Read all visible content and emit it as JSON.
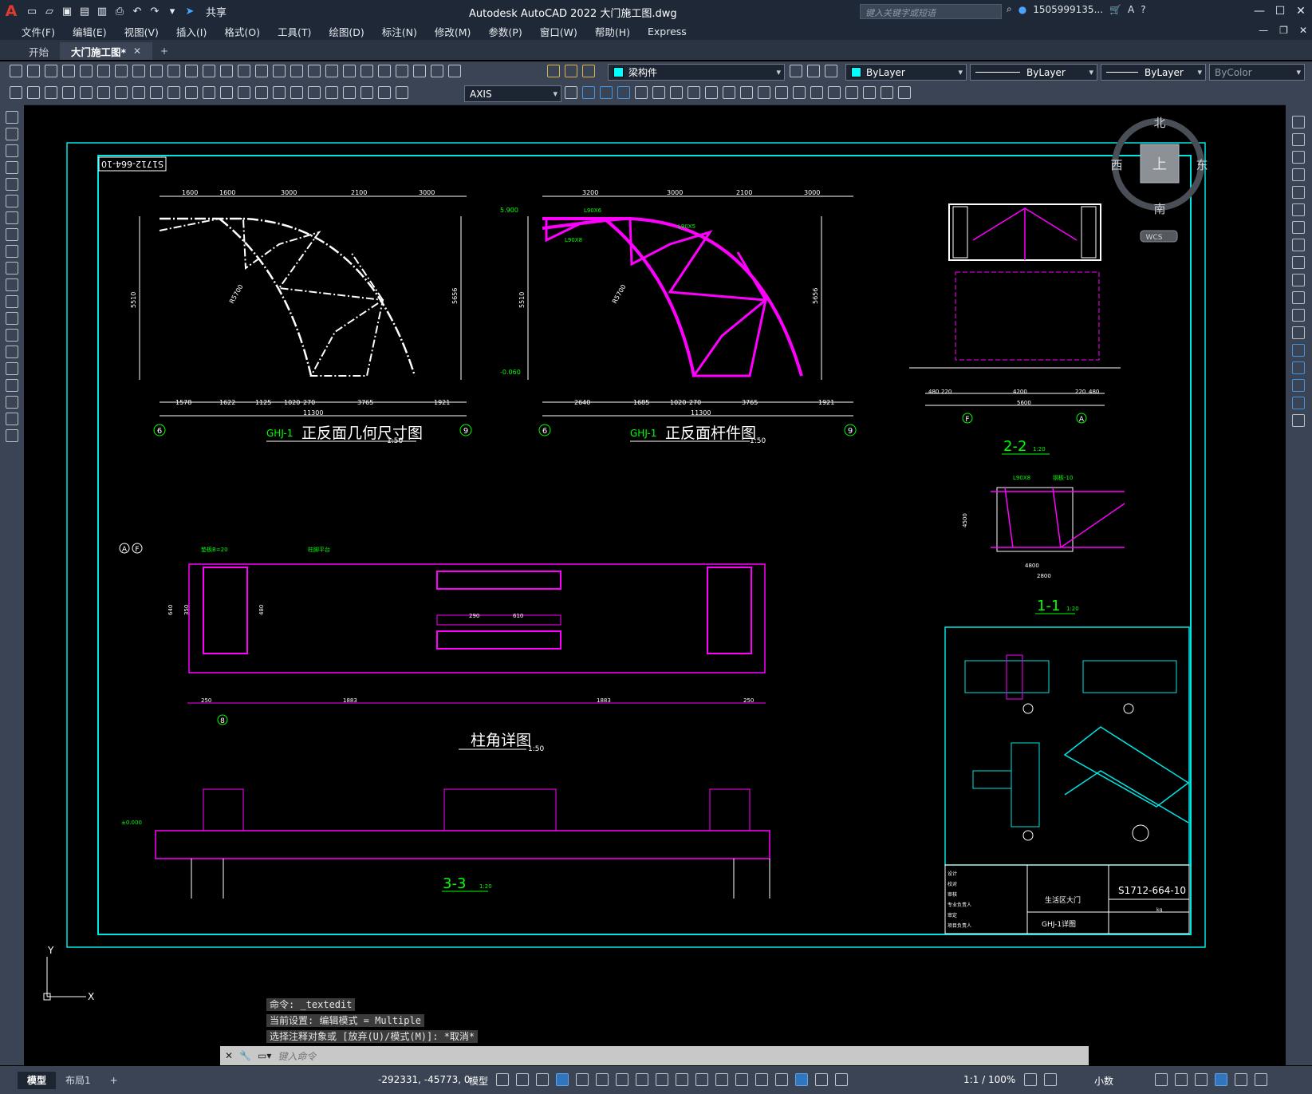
{
  "app": {
    "logo": "A",
    "title": "Autodesk AutoCAD 2022    大门施工图.dwg",
    "share": "共享",
    "search_placeholder": "键入关键字或短语",
    "user": "1505999135...",
    "help": "?"
  },
  "menu": [
    "文件(F)",
    "编辑(E)",
    "视图(V)",
    "插入(I)",
    "格式(O)",
    "工具(T)",
    "绘图(D)",
    "标注(N)",
    "修改(M)",
    "参数(P)",
    "窗口(W)",
    "帮助(H)",
    "Express"
  ],
  "file_tabs": {
    "start": "开始",
    "active": "大门施工图*",
    "close": "✕",
    "add": "+"
  },
  "toolbar": {
    "layer": "梁构件",
    "color": "ByLayer",
    "linetype": "ByLayer",
    "lineweight": "ByLayer",
    "plotstyle": "ByColor",
    "dimstyle": "AXIS"
  },
  "viewcube": {
    "north": "北",
    "south": "南",
    "east": "东",
    "west": "西",
    "top": "上",
    "wcs": "WCS"
  },
  "colors": {
    "frame": "#00e5e5",
    "magenta": "#ff00ff",
    "green": "#00ff00",
    "white": "#ffffff",
    "accent": "#2f7fd1"
  },
  "drawing": {
    "sheet_no_box": "S1712-664-10",
    "view1": {
      "title": "正反面几何尺寸图",
      "prefix": "GHJ-1",
      "scale": "1:50",
      "top_dims": [
        "1600",
        "1600",
        "3000",
        "2100",
        "3000"
      ],
      "bottom_dims": [
        "1578",
        "1622",
        "1125",
        "1020",
        "270",
        "3765",
        "1921"
      ],
      "total": "11300",
      "left_height": "5510",
      "right_height": "5656",
      "radius": "R5700",
      "axis_left": "6",
      "axis_right": "9"
    },
    "view2": {
      "title": "正反面杆件图",
      "prefix": "GHJ-1",
      "scale": "1:50",
      "top_dims": [
        "3200",
        "3000",
        "2100",
        "3000"
      ],
      "bottom_dims": [
        "2640",
        "1685",
        "1020",
        "270",
        "3765",
        "1921"
      ],
      "total": "11300",
      "left_height": "5510",
      "right_height": "5656",
      "elev_top": "5.900",
      "elev_bottom": "-0.060",
      "axis_left": "6",
      "axis_right": "9",
      "members": [
        "L90X6",
        "L90X8",
        "L90X5",
        "R5700"
      ]
    },
    "section22": {
      "title": "2-2",
      "scale": "1:20",
      "dims": [
        "480",
        "220",
        "4200",
        "220",
        "480"
      ],
      "total": "5600",
      "axis_left": "F",
      "axis_right": "A"
    },
    "section11": {
      "title": "1-1",
      "scale": "1:20",
      "dims": [
        "4800",
        "2800"
      ],
      "height": "4500",
      "labels": [
        "L90X8",
        "钢板-10"
      ]
    },
    "base_detail": {
      "title": "柱角详图",
      "scale": "1:50",
      "axes": [
        "A",
        "F"
      ],
      "axis_bottom": "8",
      "top_labels": [
        "垫板B=20",
        "柱脚平台"
      ],
      "dims_bottom": [
        "250",
        "1883",
        "1883",
        "250"
      ],
      "dims_mid": [
        "290",
        "610"
      ],
      "heights": [
        "640",
        "480",
        "350"
      ]
    },
    "section33": {
      "title": "3-3",
      "scale": "1:20",
      "elev": "±0.000"
    },
    "title_block": {
      "drawing_no": "S1712-664-10",
      "project": "生活区大门",
      "drawing_name": "GHJ-1详图",
      "roles": [
        "设计",
        "校对",
        "审核",
        "专业负责人",
        "审定",
        "项目负责人"
      ],
      "unit": "kg"
    }
  },
  "command": {
    "history": [
      "命令: _textedit",
      "当前设置: 编辑模式 = Multiple",
      "选择注释对象或 [放弃(U)/模式(M)]: *取消*"
    ],
    "placeholder": "键入命令"
  },
  "status": {
    "layout_tabs": [
      "模型",
      "布局1"
    ],
    "add": "+",
    "coords": "-292331, -45773, 0",
    "space": "模型",
    "scale": "1:1 / 100%",
    "units": "小数"
  }
}
